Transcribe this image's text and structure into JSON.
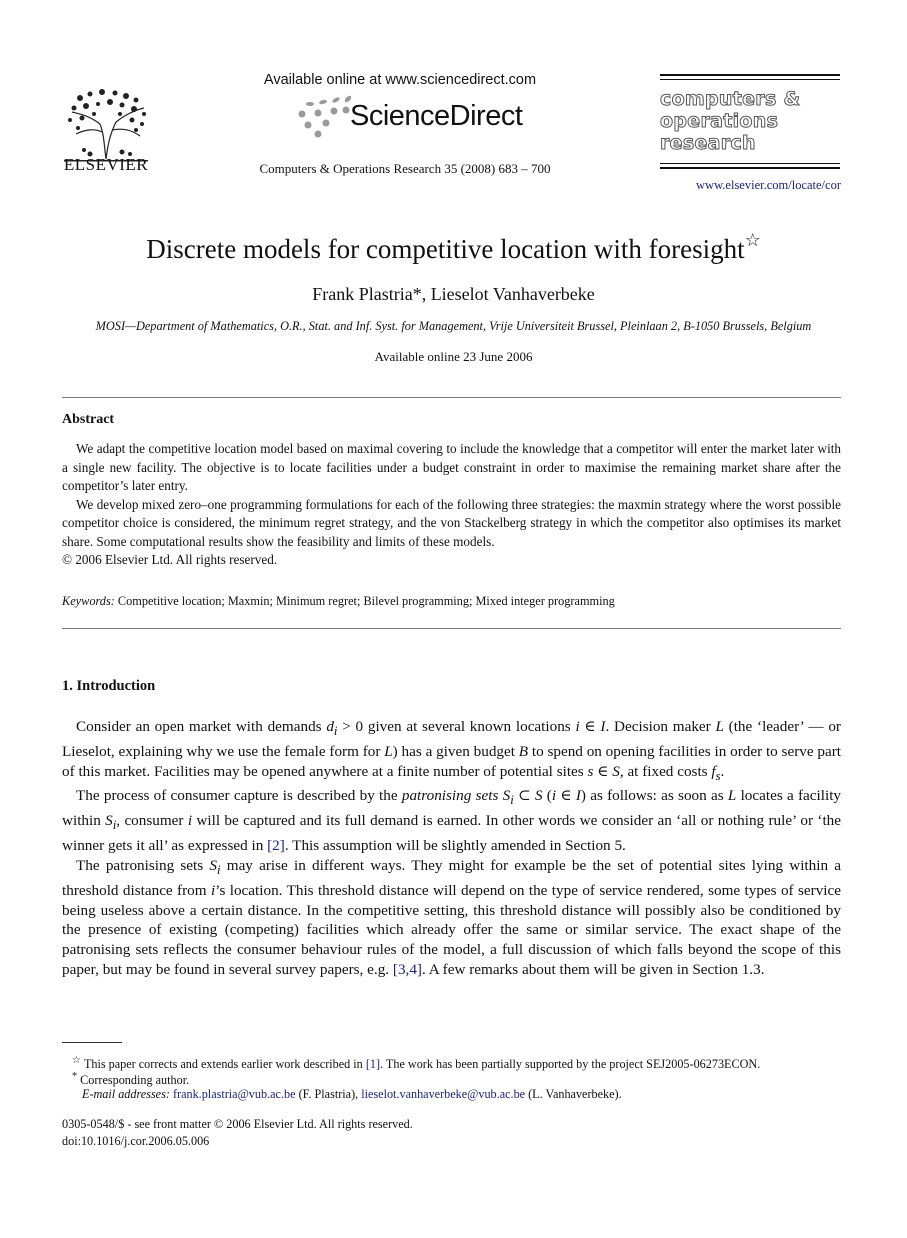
{
  "header": {
    "publisher": "ELSEVIER",
    "sciencedirect_available": "Available online at www.sciencedirect.com",
    "sciencedirect_brand": "ScienceDirect",
    "journal_reference": "Computers & Operations Research 35 (2008) 683 – 700",
    "journal_logo_lines": [
      "computers &",
      "operations",
      "research"
    ],
    "journal_url": "www.elsevier.com/locate/cor"
  },
  "article": {
    "title": "Discrete models for competitive location with foresight",
    "title_mark": "☆",
    "authors": "Frank Plastria*, Lieselot Vanhaverbeke",
    "affiliation": "MOSI—Department of Mathematics, O.R., Stat. and Inf. Syst. for Management, Vrije Universiteit Brussel, Pleinlaan 2, B-1050 Brussels, Belgium",
    "available_online": "Available online 23 June 2006"
  },
  "abstract": {
    "heading": "Abstract",
    "paragraphs": [
      "We adapt the competitive location model based on maximal covering to include the knowledge that a competitor will enter the market later with a single new facility. The objective is to locate facilities under a budget constraint in order to maximise the remaining market share after the competitor’s later entry.",
      "We develop mixed zero–one programming formulations for each of the following three strategies: the maxmin strategy where the worst possible competitor choice is considered, the minimum regret strategy, and the von Stackelberg strategy in which the competitor also optimises its market share. Some computational results show the feasibility and limits of these models."
    ],
    "copyright": "© 2006 Elsevier Ltd. All rights reserved."
  },
  "keywords": {
    "label": "Keywords:",
    "text": "Competitive location; Maxmin; Minimum regret; Bilevel programming; Mixed integer programming"
  },
  "section1": {
    "heading": "1.  Introduction",
    "p1": {
      "a": "Consider an open market with demands ",
      "d": "d",
      "i": "i",
      "b": " > 0 given at several known locations ",
      "iI": "i ∈ I",
      "c": ". Decision maker ",
      "L": "L",
      "e": " (the ‘leader’ — or Lieselot, explaining why we use the female form for ",
      "L2": "L",
      "f": ") has a given budget ",
      "B": "B",
      "g": " to spend on opening facilities in order to serve part of this market. Facilities may be opened anywhere at a finite number of potential sites ",
      "sS": "s ∈ S",
      "h": ", at fixed costs ",
      "fs": "f",
      "s": "s",
      "end": "."
    },
    "p2": {
      "a": "The process of consumer capture is described by the ",
      "em": "patronising sets",
      "Si": "S",
      "sub_i": "i",
      "b": " ⊂ ",
      "S": "S",
      "c": " (",
      "iI": "i ∈ I",
      "d": ") as follows: as soon as ",
      "L": "L",
      "e": " locates a facility within ",
      "Si2": "S",
      "sub_i2": "i",
      "f": ", consumer ",
      "ci": "i",
      "g": " will be captured and its full demand is earned. In other words we consider an ‘all or nothing rule’ or ‘the winner gets it all’ as expressed in ",
      "cite": "[2]",
      "h": ". This assumption will be slightly amended in Section 5."
    },
    "p3": {
      "a": "The patronising sets ",
      "Si": "S",
      "sub_i": "i",
      "b": " may arise in different ways. They might for example be the set of potential sites lying within a threshold distance from ",
      "ii": "i",
      "c": "’s location. This threshold distance will depend on the type of service rendered, some types of service being useless above a certain distance. In the competitive setting, this threshold distance will possibly also be conditioned by the presence of existing (competing) facilities which already offer the same or similar service. The exact shape of the patronising sets reflects the consumer behaviour rules of the model, a full discussion of which falls beyond the scope of this paper, but may be found in several survey papers, e.g. ",
      "cite": "[3,4]",
      "d": ". A few remarks about them will be given in Section 1.3."
    }
  },
  "footnotes": {
    "star_mark": "☆",
    "star_text_a": "This paper corrects and extends earlier work described in ",
    "star_cite": "[1]",
    "star_text_b": ". The work has been partially supported by the project SEJ2005-06273ECON.",
    "corr_mark": "*",
    "corr_text": "Corresponding author.",
    "email_label": "E-mail addresses:",
    "email1": "frank.plastria@vub.ac.be",
    "email1_name": " (F. Plastria), ",
    "email2": "lieselot.vanhaverbeke@vub.ac.be",
    "email2_name": " (L. Vanhaverbeke)."
  },
  "front_matter": {
    "issn": "0305-0548/$ - see front matter © 2006 Elsevier Ltd. All rights reserved.",
    "doi": "doi:10.1016/j.cor.2006.05.006"
  },
  "colors": {
    "link": "#1a237e",
    "text": "#111111"
  }
}
